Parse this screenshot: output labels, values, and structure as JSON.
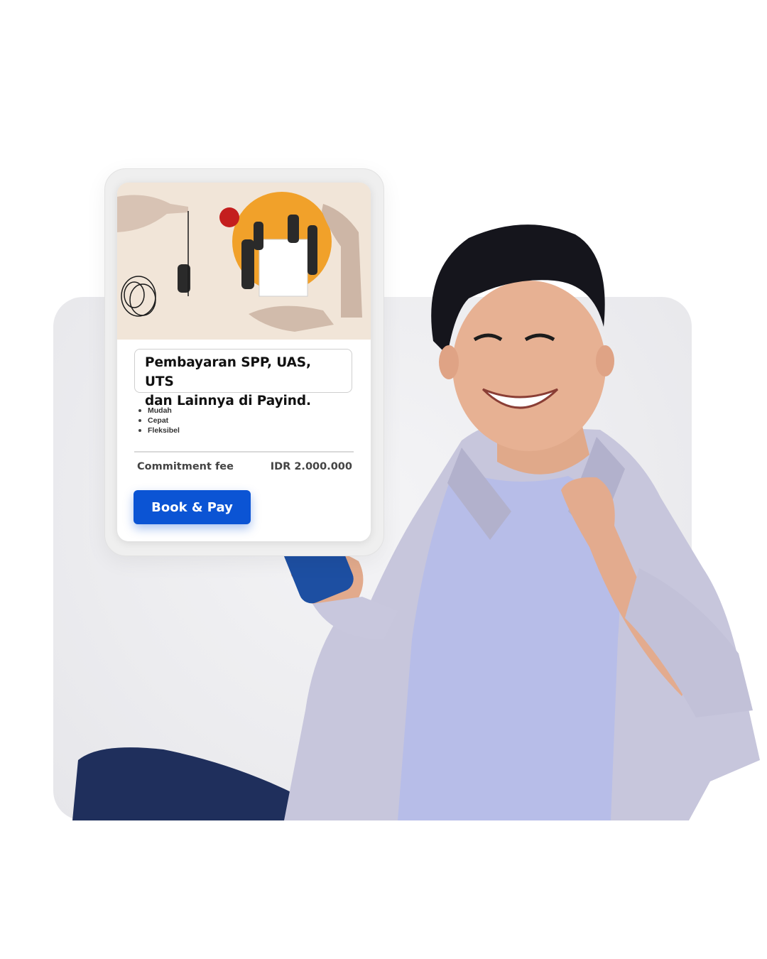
{
  "card": {
    "title": "Pembayaran SPP, UAS, UTS\ndan Lainnya di Payind.",
    "features": [
      "Mudah",
      "Cepat",
      "Fleksibel"
    ],
    "fee_label": "Commitment fee",
    "fee_value": "IDR 2.000.000",
    "button_label": "Book & Pay"
  },
  "colors": {
    "accent": "#0b54d4",
    "hero_background": "#f1e5d8",
    "hero_circle": "#f1a12a",
    "hero_dot": "#c41e1e",
    "panel": "#ececef"
  },
  "icons": {
    "hero": "collage-illustration",
    "phone": "smartphone"
  }
}
